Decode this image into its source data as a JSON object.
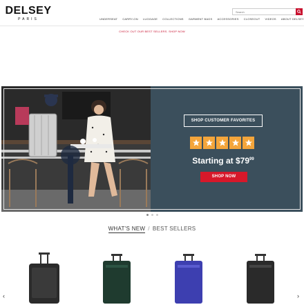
{
  "brand": {
    "name": "DELSEY",
    "sub": "PARIS"
  },
  "search": {
    "placeholder": "Search"
  },
  "nav": [
    "UNDERSEAT",
    "CARRY-ON",
    "LUGGAGE",
    "COLLECTIONS",
    "GARMENT BAGS",
    "ACCESSORIES",
    "CLOSEOUT",
    "VIDEOS",
    "ABOUT DELSEY"
  ],
  "promo": "CHECK OUT OUR BEST SELLERS. SHOP NOW",
  "banner": {
    "heading": "SHOP CUSTOMER FAVORITES",
    "rating": 5,
    "price_prefix": "Starting at $79",
    "price_cents": "99",
    "button": "SHOP NOW"
  },
  "carousel": {
    "slides": 3,
    "active": 0
  },
  "tabs": {
    "active": "WHAT'S NEW",
    "separator": "/",
    "other": "BEST SELLERS"
  },
  "arrows": {
    "left": "‹",
    "right": "›"
  },
  "products": [
    {
      "icon": "suitcase-icon",
      "color": "#2b2b2b"
    },
    {
      "icon": "suitcase-icon",
      "color": "#1f3b2f"
    },
    {
      "icon": "suitcase-icon",
      "color": "#3d3fb0"
    },
    {
      "icon": "suitcase-icon",
      "color": "#2a2a2a"
    }
  ],
  "colors": {
    "accent": "#c8102e",
    "banner_bg": "#3b4f5c",
    "star": "#f4a53b"
  }
}
